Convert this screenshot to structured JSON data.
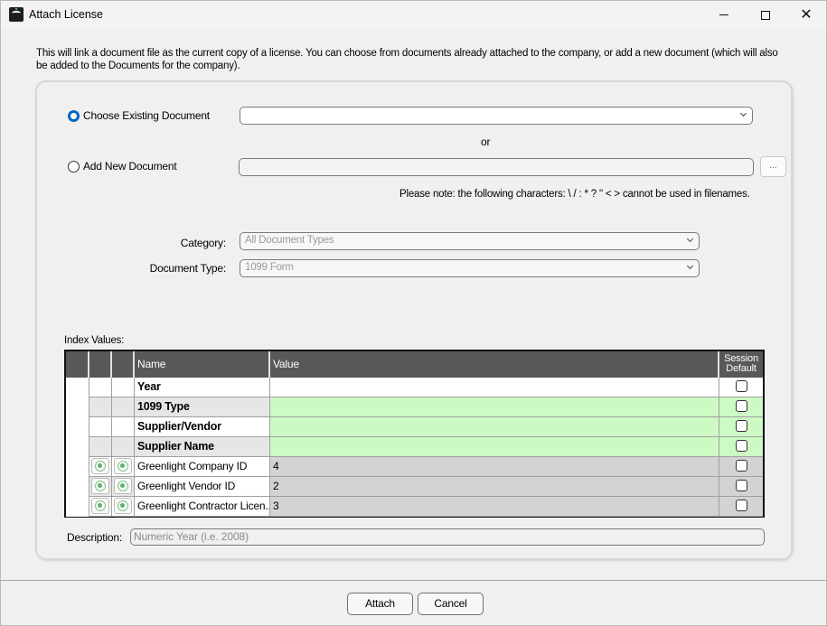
{
  "window": {
    "title": "Attach License",
    "icon": "app-logo-icon",
    "controls": {
      "minimize": "minimize-icon",
      "maximize": "maximize-icon",
      "close": "close-icon"
    }
  },
  "intro_text": "This will link a document file as the current copy of a license.  You can choose from documents already attached to the company, or add a new document (which will also be added to the Documents for the  company).",
  "source": {
    "choose_existing_label": "Choose Existing Document",
    "choose_existing_selected": true,
    "existing_document_value": "",
    "or_label": "or",
    "add_new_label": "Add New Document",
    "add_new_selected": false,
    "new_document_path": "",
    "browse_label": "...",
    "filename_note": "Please note:  the following characters:  \\ / : * ? \" < > cannot be used in filenames."
  },
  "category": {
    "label": "Category:",
    "value": "All Document Types"
  },
  "document_type": {
    "label": "Document Type:",
    "value": "1099 Form"
  },
  "index_values": {
    "label": "Index Values:",
    "columns": [
      "",
      "",
      "",
      "Name",
      "Value",
      "Session Default"
    ],
    "session_default_line1": "Session",
    "session_default_line2": "Default",
    "rows": [
      {
        "name": "Year",
        "value": "",
        "bold": true,
        "style": "white",
        "has_icons": false,
        "session_default": false
      },
      {
        "name": "1099 Type",
        "value": "",
        "bold": true,
        "style": "green",
        "has_icons": false,
        "session_default": false
      },
      {
        "name": "Supplier/Vendor",
        "value": "",
        "bold": true,
        "style": "green",
        "has_icons": false,
        "session_default": false
      },
      {
        "name": "Supplier Name",
        "value": "",
        "bold": true,
        "style": "green",
        "has_icons": false,
        "session_default": false
      },
      {
        "name": "Greenlight Company ID",
        "value": "4",
        "bold": false,
        "style": "gray",
        "has_icons": true,
        "session_default": false
      },
      {
        "name": "Greenlight Vendor ID",
        "value": "2",
        "bold": false,
        "style": "gray",
        "has_icons": true,
        "session_default": false
      },
      {
        "name": "Greenlight Contractor Licen...",
        "value": "3",
        "bold": false,
        "style": "gray",
        "has_icons": true,
        "session_default": false
      }
    ]
  },
  "description": {
    "label": "Description:",
    "placeholder": "Numeric Year (i.e. 2008)"
  },
  "buttons": {
    "attach": "Attach",
    "cancel": "Cancel"
  }
}
